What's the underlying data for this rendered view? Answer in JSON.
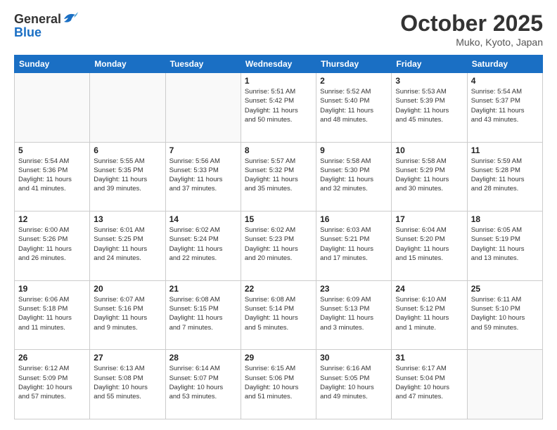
{
  "logo": {
    "general": "General",
    "blue": "Blue"
  },
  "title": "October 2025",
  "location": "Muko, Kyoto, Japan",
  "days_of_week": [
    "Sunday",
    "Monday",
    "Tuesday",
    "Wednesday",
    "Thursday",
    "Friday",
    "Saturday"
  ],
  "weeks": [
    [
      {
        "day": "",
        "info": ""
      },
      {
        "day": "",
        "info": ""
      },
      {
        "day": "",
        "info": ""
      },
      {
        "day": "1",
        "info": "Sunrise: 5:51 AM\nSunset: 5:42 PM\nDaylight: 11 hours\nand 50 minutes."
      },
      {
        "day": "2",
        "info": "Sunrise: 5:52 AM\nSunset: 5:40 PM\nDaylight: 11 hours\nand 48 minutes."
      },
      {
        "day": "3",
        "info": "Sunrise: 5:53 AM\nSunset: 5:39 PM\nDaylight: 11 hours\nand 45 minutes."
      },
      {
        "day": "4",
        "info": "Sunrise: 5:54 AM\nSunset: 5:37 PM\nDaylight: 11 hours\nand 43 minutes."
      }
    ],
    [
      {
        "day": "5",
        "info": "Sunrise: 5:54 AM\nSunset: 5:36 PM\nDaylight: 11 hours\nand 41 minutes."
      },
      {
        "day": "6",
        "info": "Sunrise: 5:55 AM\nSunset: 5:35 PM\nDaylight: 11 hours\nand 39 minutes."
      },
      {
        "day": "7",
        "info": "Sunrise: 5:56 AM\nSunset: 5:33 PM\nDaylight: 11 hours\nand 37 minutes."
      },
      {
        "day": "8",
        "info": "Sunrise: 5:57 AM\nSunset: 5:32 PM\nDaylight: 11 hours\nand 35 minutes."
      },
      {
        "day": "9",
        "info": "Sunrise: 5:58 AM\nSunset: 5:30 PM\nDaylight: 11 hours\nand 32 minutes."
      },
      {
        "day": "10",
        "info": "Sunrise: 5:58 AM\nSunset: 5:29 PM\nDaylight: 11 hours\nand 30 minutes."
      },
      {
        "day": "11",
        "info": "Sunrise: 5:59 AM\nSunset: 5:28 PM\nDaylight: 11 hours\nand 28 minutes."
      }
    ],
    [
      {
        "day": "12",
        "info": "Sunrise: 6:00 AM\nSunset: 5:26 PM\nDaylight: 11 hours\nand 26 minutes."
      },
      {
        "day": "13",
        "info": "Sunrise: 6:01 AM\nSunset: 5:25 PM\nDaylight: 11 hours\nand 24 minutes."
      },
      {
        "day": "14",
        "info": "Sunrise: 6:02 AM\nSunset: 5:24 PM\nDaylight: 11 hours\nand 22 minutes."
      },
      {
        "day": "15",
        "info": "Sunrise: 6:02 AM\nSunset: 5:23 PM\nDaylight: 11 hours\nand 20 minutes."
      },
      {
        "day": "16",
        "info": "Sunrise: 6:03 AM\nSunset: 5:21 PM\nDaylight: 11 hours\nand 17 minutes."
      },
      {
        "day": "17",
        "info": "Sunrise: 6:04 AM\nSunset: 5:20 PM\nDaylight: 11 hours\nand 15 minutes."
      },
      {
        "day": "18",
        "info": "Sunrise: 6:05 AM\nSunset: 5:19 PM\nDaylight: 11 hours\nand 13 minutes."
      }
    ],
    [
      {
        "day": "19",
        "info": "Sunrise: 6:06 AM\nSunset: 5:18 PM\nDaylight: 11 hours\nand 11 minutes."
      },
      {
        "day": "20",
        "info": "Sunrise: 6:07 AM\nSunset: 5:16 PM\nDaylight: 11 hours\nand 9 minutes."
      },
      {
        "day": "21",
        "info": "Sunrise: 6:08 AM\nSunset: 5:15 PM\nDaylight: 11 hours\nand 7 minutes."
      },
      {
        "day": "22",
        "info": "Sunrise: 6:08 AM\nSunset: 5:14 PM\nDaylight: 11 hours\nand 5 minutes."
      },
      {
        "day": "23",
        "info": "Sunrise: 6:09 AM\nSunset: 5:13 PM\nDaylight: 11 hours\nand 3 minutes."
      },
      {
        "day": "24",
        "info": "Sunrise: 6:10 AM\nSunset: 5:12 PM\nDaylight: 11 hours\nand 1 minute."
      },
      {
        "day": "25",
        "info": "Sunrise: 6:11 AM\nSunset: 5:10 PM\nDaylight: 10 hours\nand 59 minutes."
      }
    ],
    [
      {
        "day": "26",
        "info": "Sunrise: 6:12 AM\nSunset: 5:09 PM\nDaylight: 10 hours\nand 57 minutes."
      },
      {
        "day": "27",
        "info": "Sunrise: 6:13 AM\nSunset: 5:08 PM\nDaylight: 10 hours\nand 55 minutes."
      },
      {
        "day": "28",
        "info": "Sunrise: 6:14 AM\nSunset: 5:07 PM\nDaylight: 10 hours\nand 53 minutes."
      },
      {
        "day": "29",
        "info": "Sunrise: 6:15 AM\nSunset: 5:06 PM\nDaylight: 10 hours\nand 51 minutes."
      },
      {
        "day": "30",
        "info": "Sunrise: 6:16 AM\nSunset: 5:05 PM\nDaylight: 10 hours\nand 49 minutes."
      },
      {
        "day": "31",
        "info": "Sunrise: 6:17 AM\nSunset: 5:04 PM\nDaylight: 10 hours\nand 47 minutes."
      },
      {
        "day": "",
        "info": ""
      }
    ]
  ]
}
